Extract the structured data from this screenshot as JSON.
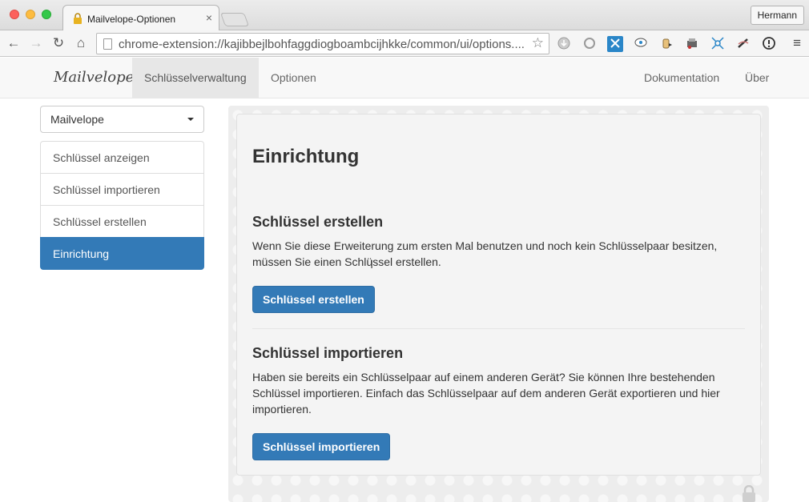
{
  "browser": {
    "tab_title": "Mailvelope-Optionen",
    "tab_close": "×",
    "profile_name": "Hermann",
    "url": "chrome-extension://kajibbejlbohfaggdiogboambcijhkke/common/ui/options....",
    "nav_back": "←",
    "nav_forward": "→",
    "nav_reload": "↻",
    "nav_home": "⌂",
    "star": "☆",
    "menu": "≡"
  },
  "navbar": {
    "brand": "Mailvelope",
    "items": [
      {
        "label": "Schlüsselverwaltung",
        "active": true
      },
      {
        "label": "Optionen",
        "active": false
      }
    ],
    "right_items": [
      {
        "label": "Dokumentation"
      },
      {
        "label": "Über"
      }
    ]
  },
  "sidebar": {
    "keyring_select": "Mailvelope",
    "items": [
      {
        "label": "Schlüssel anzeigen",
        "active": false
      },
      {
        "label": "Schlüssel importieren",
        "active": false
      },
      {
        "label": "Schlüssel erstellen",
        "active": false
      },
      {
        "label": "Einrichtung",
        "active": true
      }
    ]
  },
  "main": {
    "title": "Einrichtung",
    "create": {
      "heading": "Schlüssel erstellen",
      "text": "Wenn Sie diese Erweiterung zum ersten Mal benutzen und noch kein Schlüsselpaar besitzen, müssen Sie einen Schlüssel erstellen.",
      "button": "Schlüssel erstellen"
    },
    "import": {
      "heading": "Schlüssel importieren",
      "text": "Haben sie bereits ein Schlüsselpaar auf einem anderen Gerät? Sie können Ihre bestehenden Schlüssel importieren. Einfach das Schlüsselpaar auf dem anderen Gerät exportieren und hier importieren.",
      "button": "Schlüssel importieren"
    }
  },
  "colors": {
    "primary": "#337ab7",
    "active_list": "#337ab7"
  }
}
